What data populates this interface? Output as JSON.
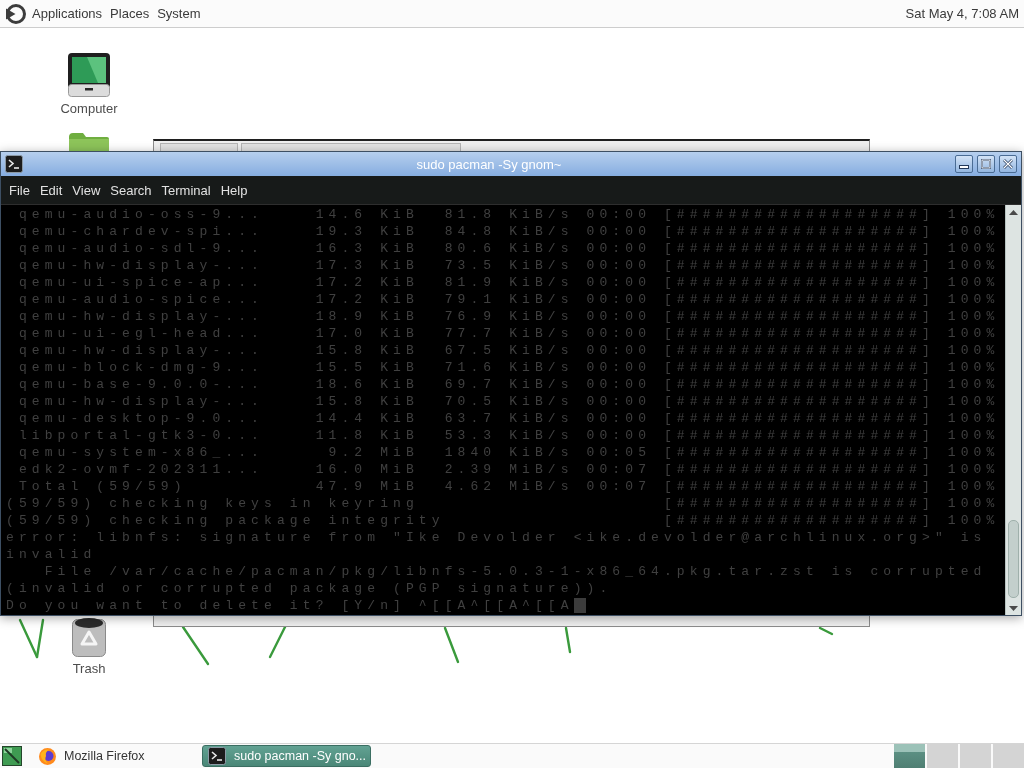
{
  "top_panel": {
    "menus": [
      "Applications",
      "Places",
      "System"
    ],
    "clock": "Sat May 4, 7:08 AM"
  },
  "desktop_icons": [
    {
      "kind": "computer",
      "label": "Computer"
    },
    {
      "kind": "folder"
    },
    {
      "kind": "trash",
      "label": "Trash"
    }
  ],
  "terminal": {
    "title": "sudo pacman -Sy gnom~",
    "menus": [
      "File",
      "Edit",
      "View",
      "Search",
      "Terminal",
      "Help"
    ],
    "lines": [
      " qemu-audio-oss-9...    14.6 KiB  81.8 KiB/s 00:00 [###################] 100%",
      " qemu-chardev-spi...    19.3 KiB  84.8 KiB/s 00:00 [###################] 100%",
      " qemu-audio-sdl-9...    16.3 KiB  80.6 KiB/s 00:00 [###################] 100%",
      " qemu-hw-display-...    17.3 KiB  73.5 KiB/s 00:00 [###################] 100%",
      " qemu-ui-spice-ap...    17.2 KiB  81.9 KiB/s 00:00 [###################] 100%",
      " qemu-audio-spice...    17.2 KiB  79.1 KiB/s 00:00 [###################] 100%",
      " qemu-hw-display-...    18.9 KiB  76.9 KiB/s 00:00 [###################] 100%",
      " qemu-ui-egl-head...    17.0 KiB  77.7 KiB/s 00:00 [###################] 100%",
      " qemu-hw-display-...    15.8 KiB  67.5 KiB/s 00:00 [###################] 100%",
      " qemu-block-dmg-9...    15.5 KiB  71.6 KiB/s 00:00 [###################] 100%",
      " qemu-base-9.0.0-...    18.6 KiB  69.7 KiB/s 00:00 [###################] 100%",
      " qemu-hw-display-...    15.8 KiB  70.5 KiB/s 00:00 [###################] 100%",
      " qemu-desktop-9.0...    14.4 KiB  63.7 KiB/s 00:00 [###################] 100%",
      " libportal-gtk3-0...    11.8 KiB  53.3 KiB/s 00:00 [###################] 100%",
      " qemu-system-x86_...     9.2 MiB  1840 KiB/s 00:05 [###################] 100%",
      " edk2-ovmf-202311...    16.0 MiB  2.39 MiB/s 00:07 [###################] 100%",
      " Total (59/59)          47.9 MiB  4.62 MiB/s 00:07 [###################] 100%",
      "(59/59) checking keys in keyring                   [###################] 100%",
      "(59/59) checking package integrity                 [###################] 100%",
      "error: libnfs: signature from \"Ike Devolder <ike.devolder@archlinux.org>\" is",
      "invalid",
      "   File /var/cache/pacman/pkg/libnfs-5.0.3-1-x86_64.pkg.tar.zst is corrupted",
      "(invalid or corrupted package (PGP signature)).",
      "Do you want to delete it? [Y/n] ^[[A^[[A^[[A"
    ]
  },
  "taskbar": {
    "tasks": [
      {
        "kind": "browser",
        "label": "Mozilla Firefox",
        "selected": false
      },
      {
        "kind": "terminal",
        "label": "sudo pacman -Sy gno...",
        "selected": true
      }
    ],
    "workspaces": [
      {
        "selected": true
      },
      {
        "selected": false
      },
      {
        "selected": false
      },
      {
        "selected": false
      }
    ]
  }
}
